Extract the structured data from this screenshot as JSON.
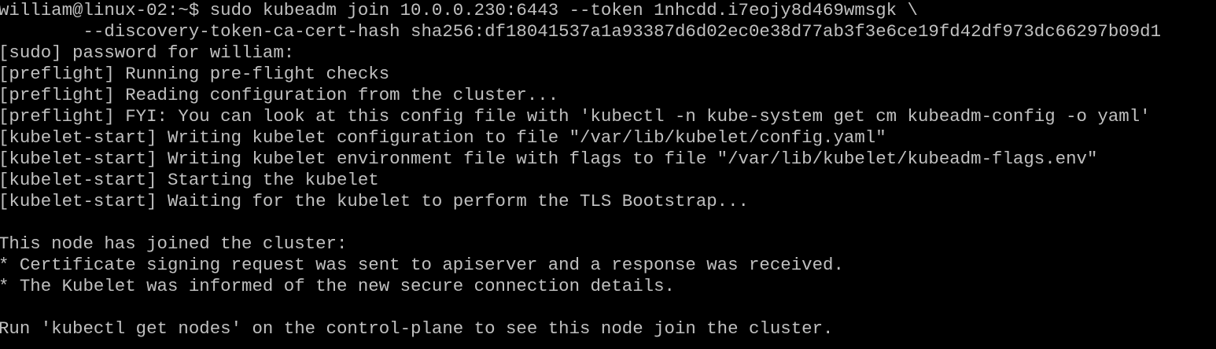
{
  "terminal": {
    "background_color": "#000000",
    "text_color": "#c0c0c0",
    "lines": [
      "william@linux-02:~$ sudo kubeadm join 10.0.0.230:6443 --token 1nhcdd.i7eojy8d469wmsgk \\",
      "        --discovery-token-ca-cert-hash sha256:df18041537a1a93387d6d02ec0e38d77ab3f3e6ce19fd42df973dc66297b09d1",
      "[sudo] password for william:",
      "[preflight] Running pre-flight checks",
      "[preflight] Reading configuration from the cluster...",
      "[preflight] FYI: You can look at this config file with 'kubectl -n kube-system get cm kubeadm-config -o yaml'",
      "[kubelet-start] Writing kubelet configuration to file \"/var/lib/kubelet/config.yaml\"",
      "[kubelet-start] Writing kubelet environment file with flags to file \"/var/lib/kubelet/kubeadm-flags.env\"",
      "[kubelet-start] Starting the kubelet",
      "[kubelet-start] Waiting for the kubelet to perform the TLS Bootstrap...",
      "",
      "This node has joined the cluster:",
      "* Certificate signing request was sent to apiserver and a response was received.",
      "* The Kubelet was informed of the new secure connection details.",
      "",
      "Run 'kubectl get nodes' on the control-plane to see this node join the cluster."
    ]
  }
}
